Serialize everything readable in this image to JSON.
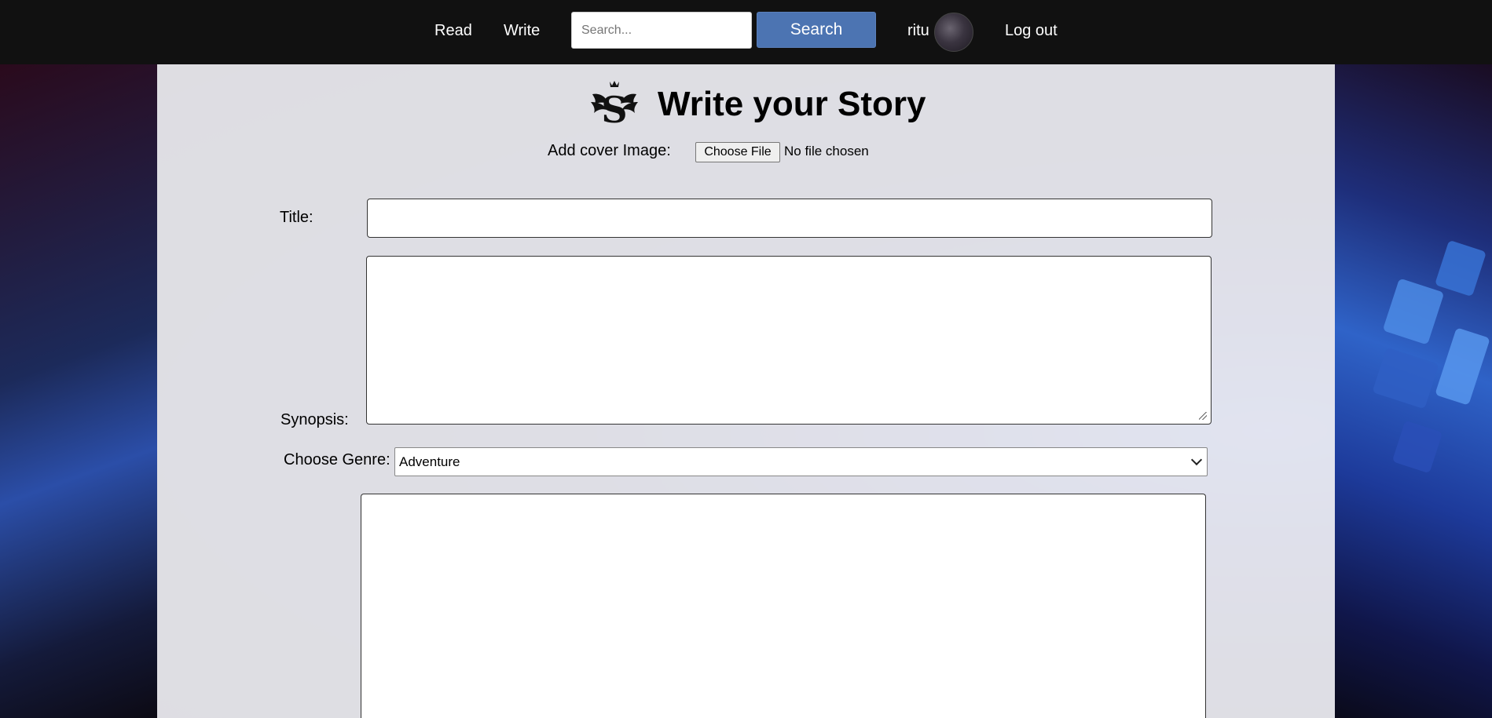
{
  "nav": {
    "read": "Read",
    "write": "Write",
    "search_placeholder": "Search...",
    "search_button": "Search",
    "username": "ritu",
    "logout": "Log out"
  },
  "form": {
    "title": "Write your Story",
    "cover_label": "Add cover Image:",
    "choose_file": "Choose File",
    "file_status": "No file chosen",
    "title_label": "Title:",
    "title_value": "",
    "synopsis_label": "Synopsis:",
    "synopsis_value": "",
    "genre_label": "Choose Genre:",
    "genre_selected": "Adventure",
    "story_value": ""
  },
  "colors": {
    "nav_bg": "#111111",
    "search_button": "#4c74b2",
    "panel_bg": "#eeeef2"
  },
  "icons": {
    "logo": "winged-s-crest-logo",
    "select_arrow": "chevron-down-icon"
  }
}
